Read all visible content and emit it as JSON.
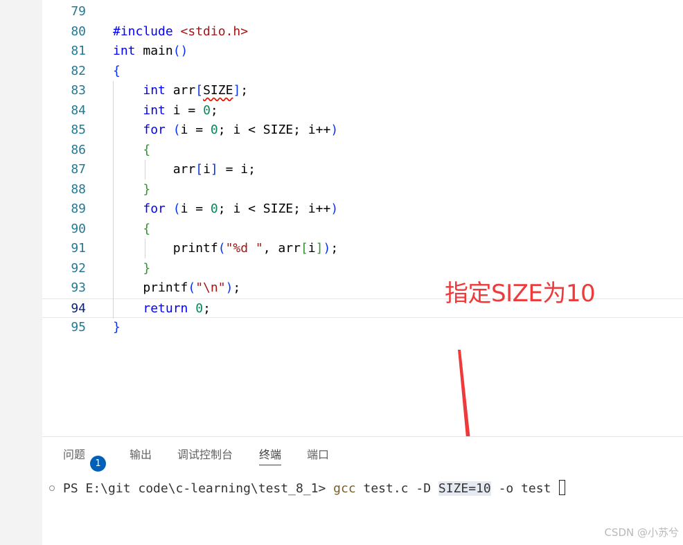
{
  "editor": {
    "current_line": "94",
    "lines": [
      {
        "n": "79",
        "code": ""
      },
      {
        "n": "80",
        "code": "#include <stdio.h>"
      },
      {
        "n": "81",
        "code": "int main()"
      },
      {
        "n": "82",
        "code": "{"
      },
      {
        "n": "83",
        "code": "    int arr[SIZE];"
      },
      {
        "n": "84",
        "code": "    int i = 0;"
      },
      {
        "n": "85",
        "code": "    for (i = 0; i < SIZE; i++)"
      },
      {
        "n": "86",
        "code": "    {"
      },
      {
        "n": "87",
        "code": "        arr[i] = i;"
      },
      {
        "n": "88",
        "code": "    }"
      },
      {
        "n": "89",
        "code": "    for (i = 0; i < SIZE; i++)"
      },
      {
        "n": "90",
        "code": "    {"
      },
      {
        "n": "91",
        "code": "        printf(\"%d \", arr[i]);"
      },
      {
        "n": "92",
        "code": "    }"
      },
      {
        "n": "93",
        "code": "    printf(\"\\n\");"
      },
      {
        "n": "94",
        "code": "    return 0;"
      },
      {
        "n": "95",
        "code": "}"
      }
    ]
  },
  "annotation": {
    "text": "指定SIZE为10",
    "color": "#ee3a3a"
  },
  "panel": {
    "tabs": [
      {
        "label": "问题",
        "badge": "1"
      },
      {
        "label": "输出"
      },
      {
        "label": "调试控制台"
      },
      {
        "label": "终端",
        "active": true
      },
      {
        "label": "端口"
      }
    ],
    "terminal": {
      "prompt": "PS E:\\git code\\c-learning\\test_8_1> ",
      "command": "gcc",
      "args_before": " test.c -D ",
      "highlight": "SIZE=10",
      "args_after": " -o test"
    }
  },
  "watermark": "CSDN @小苏兮",
  "icons": [
    "terminal-status-circle-icon",
    "cursor-block-icon",
    "arrow-down-icon"
  ]
}
